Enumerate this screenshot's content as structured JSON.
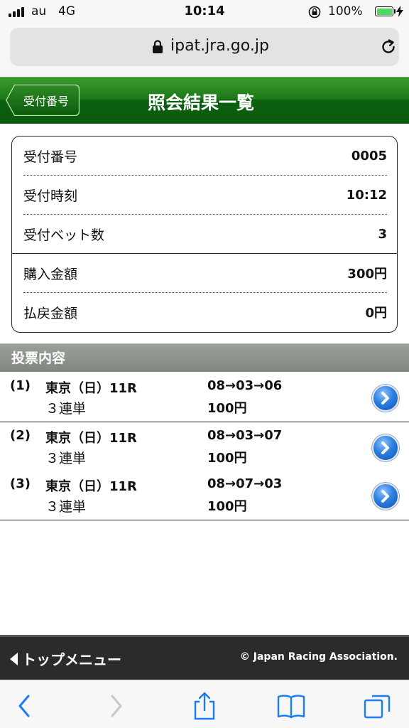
{
  "status_bar": {
    "carrier": "au",
    "network": "4G",
    "time": "10:14",
    "battery_percent": "100%"
  },
  "browser": {
    "url": "ipat.jra.go.jp"
  },
  "header": {
    "back_label": "受付番号",
    "title": "照会結果一覧"
  },
  "summary": {
    "rows": [
      {
        "label": "受付番号",
        "value": "0005"
      },
      {
        "label": "受付時刻",
        "value": "10:12"
      },
      {
        "label": "受付ベット数",
        "value": "3"
      },
      {
        "label": "購入金額",
        "value": "300円"
      },
      {
        "label": "払戻金額",
        "value": "0円"
      }
    ]
  },
  "section": {
    "title": "投票内容"
  },
  "bets": [
    {
      "index": "(1)",
      "race": "東京（日）11R",
      "type": "３連単",
      "combination": "08→03→06",
      "amount": "100円"
    },
    {
      "index": "(2)",
      "race": "東京（日）11R",
      "type": "３連単",
      "combination": "08→03→07",
      "amount": "100円"
    },
    {
      "index": "(3)",
      "race": "東京（日）11R",
      "type": "３連単",
      "combination": "08→07→03",
      "amount": "100円"
    }
  ],
  "footer": {
    "top_menu_label": "トップメニュー",
    "copyright": "© Japan Racing Association."
  },
  "colors": {
    "header_green": "#0c6010",
    "section_gray": "#8a918a",
    "footer_dark": "#2b2b2b",
    "ios_blue": "#1a7cf5",
    "battery_green": "#4cd964"
  }
}
